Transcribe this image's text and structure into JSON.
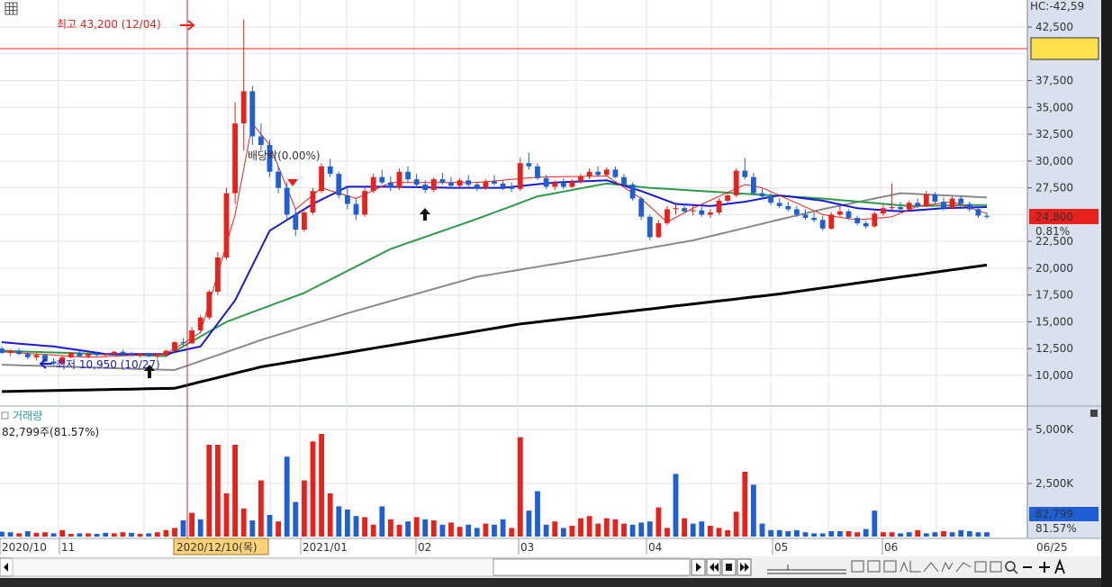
{
  "chart_data": {
    "type": "candlestick",
    "price_axis": {
      "ticks": [
        "42,500",
        "37,500",
        "35,000",
        "32,500",
        "30,000",
        "27,500",
        "22,500",
        "20,000",
        "17,500",
        "15,000",
        "12,500",
        "10,000"
      ],
      "top_label": "HC:-42,59",
      "current_price": "24,800",
      "current_change": "0.81%"
    },
    "volume_axis": {
      "ticks": [
        "5,000K",
        "2,500K"
      ],
      "current_volume": "82,799",
      "current_ratio": "81.57%"
    },
    "volume_legend": {
      "title": "거래량",
      "value": "82,799주(81.57%)"
    },
    "annotations": {
      "high": "최고 43,200 (12/04)",
      "low": "최저 10,950 (10/27)",
      "dividend": "배당락(0.00%)"
    },
    "x_labels": [
      "2020/10",
      "11",
      "2021/01",
      "02",
      "03",
      "04",
      "05",
      "06"
    ],
    "cursor_label": "2020/12/10(목)",
    "right_date": "06/25",
    "colors": {
      "up": "#e8211b",
      "down": "#1f5fd6",
      "ma5": "#e8211b",
      "ma20": "#1a1ad6",
      "ma60": "#2e9a4d",
      "ma120": "#8a8a8a",
      "ma240": "#000000"
    },
    "candles": [
      [
        12500,
        12700,
        12000,
        12100
      ],
      [
        12100,
        12400,
        11800,
        12300
      ],
      [
        12300,
        12500,
        11900,
        12000
      ],
      [
        12000,
        12200,
        11500,
        11700
      ],
      [
        11700,
        12100,
        11400,
        11900
      ],
      [
        11900,
        12000,
        11200,
        11300
      ],
      [
        11300,
        11600,
        10950,
        11100
      ],
      [
        11100,
        11800,
        11000,
        11700
      ],
      [
        11700,
        12200,
        11600,
        12100
      ],
      [
        12100,
        12300,
        11700,
        11800
      ],
      [
        11800,
        12100,
        11600,
        12000
      ],
      [
        12000,
        12200,
        11800,
        11900
      ],
      [
        11900,
        12100,
        11700,
        12000
      ],
      [
        12000,
        12300,
        11900,
        12200
      ],
      [
        12200,
        12400,
        11900,
        12000
      ],
      [
        12000,
        12200,
        11800,
        11900
      ],
      [
        11900,
        12100,
        11700,
        12000
      ],
      [
        12000,
        12100,
        11700,
        11800
      ],
      [
        11800,
        12000,
        11600,
        11900
      ],
      [
        11900,
        12400,
        11800,
        12300
      ],
      [
        12300,
        13200,
        12200,
        13100
      ],
      [
        13100,
        13500,
        12800,
        13000
      ],
      [
        13000,
        14500,
        12900,
        14200
      ],
      [
        14200,
        15600,
        14000,
        15400
      ],
      [
        15400,
        18000,
        15200,
        17800
      ],
      [
        17800,
        21500,
        17500,
        21000
      ],
      [
        21000,
        27500,
        20800,
        27000
      ],
      [
        27000,
        35500,
        26000,
        33500
      ],
      [
        33500,
        43200,
        31000,
        36500
      ],
      [
        36500,
        37000,
        31500,
        32300
      ],
      [
        32300,
        33500,
        31000,
        31500
      ],
      [
        31500,
        32000,
        28500,
        29000
      ],
      [
        29000,
        29500,
        27000,
        27500
      ],
      [
        27500,
        28000,
        24500,
        25000
      ],
      [
        25000,
        25500,
        23000,
        23600
      ],
      [
        23600,
        25500,
        23400,
        25200
      ],
      [
        25200,
        27500,
        25000,
        27200
      ],
      [
        27200,
        29800,
        27000,
        29500
      ],
      [
        29500,
        30200,
        28500,
        28800
      ],
      [
        28800,
        29000,
        26500,
        26800
      ],
      [
        26800,
        27500,
        25500,
        26000
      ],
      [
        26000,
        26500,
        24500,
        25000
      ],
      [
        25000,
        27500,
        24800,
        27200
      ],
      [
        27200,
        28800,
        27000,
        28500
      ],
      [
        28500,
        29200,
        27800,
        28000
      ],
      [
        28000,
        28600,
        27200,
        27500
      ],
      [
        27500,
        29300,
        27300,
        29000
      ],
      [
        29000,
        29500,
        28000,
        28300
      ],
      [
        28300,
        28800,
        27500,
        27800
      ],
      [
        27800,
        28200,
        27000,
        27300
      ],
      [
        27300,
        28500,
        27100,
        28300
      ],
      [
        28300,
        28900,
        27800,
        28000
      ],
      [
        28000,
        28500,
        27400,
        27700
      ],
      [
        27700,
        28400,
        27500,
        28200
      ],
      [
        28200,
        28700,
        27600,
        27800
      ],
      [
        27800,
        28100,
        27200,
        27500
      ],
      [
        27500,
        28300,
        27300,
        28100
      ],
      [
        28100,
        28700,
        27700,
        27900
      ],
      [
        27900,
        28200,
        27300,
        27600
      ],
      [
        27600,
        28000,
        27100,
        27400
      ],
      [
        27400,
        30300,
        27200,
        29800
      ],
      [
        29800,
        30800,
        29200,
        29500
      ],
      [
        29500,
        29800,
        28200,
        28400
      ],
      [
        28400,
        28700,
        27400,
        27600
      ],
      [
        27600,
        28200,
        27300,
        28000
      ],
      [
        28000,
        28400,
        27400,
        27600
      ],
      [
        27600,
        28300,
        27500,
        28100
      ],
      [
        28100,
        28800,
        27900,
        28600
      ],
      [
        28600,
        29300,
        28300,
        29000
      ],
      [
        29000,
        29500,
        28500,
        28700
      ],
      [
        28700,
        29400,
        28600,
        29200
      ],
      [
        29200,
        29500,
        28400,
        28500
      ],
      [
        28500,
        28800,
        27600,
        27800
      ],
      [
        27800,
        28000,
        26300,
        26500
      ],
      [
        26500,
        26700,
        24500,
        24800
      ],
      [
        24800,
        25000,
        22600,
        22900
      ],
      [
        22900,
        24500,
        22800,
        24200
      ],
      [
        24200,
        25800,
        24000,
        25500
      ],
      [
        25500,
        26000,
        25000,
        25600
      ],
      [
        25600,
        26000,
        25100,
        25300
      ],
      [
        25300,
        25800,
        24900,
        25400
      ],
      [
        25400,
        25700,
        24800,
        25000
      ],
      [
        25000,
        25500,
        24700,
        25200
      ],
      [
        25200,
        26500,
        25000,
        26300
      ],
      [
        26300,
        27000,
        26000,
        26800
      ],
      [
        26800,
        29300,
        26600,
        29100
      ],
      [
        29100,
        30300,
        28300,
        28500
      ],
      [
        28500,
        28900,
        26800,
        27000
      ],
      [
        27000,
        27400,
        26400,
        26700
      ],
      [
        26700,
        27000,
        25900,
        26100
      ],
      [
        26100,
        26500,
        25600,
        25800
      ],
      [
        25800,
        26200,
        25300,
        25500
      ],
      [
        25500,
        25800,
        24800,
        25000
      ],
      [
        25000,
        25500,
        24500,
        24700
      ],
      [
        24700,
        25200,
        24300,
        24500
      ],
      [
        24500,
        24900,
        23500,
        23700
      ],
      [
        23700,
        25200,
        23600,
        25000
      ],
      [
        25000,
        25800,
        24800,
        25300
      ],
      [
        25300,
        25500,
        24500,
        24700
      ],
      [
        24700,
        24900,
        24000,
        24200
      ],
      [
        24200,
        24400,
        23700,
        23900
      ],
      [
        23900,
        25300,
        23800,
        25100
      ],
      [
        25100,
        25900,
        24900,
        25600
      ],
      [
        25600,
        27900,
        25400,
        25700
      ],
      [
        25700,
        26200,
        25300,
        25500
      ],
      [
        25500,
        26300,
        25400,
        26100
      ],
      [
        26100,
        26500,
        25600,
        25800
      ],
      [
        25800,
        27200,
        25700,
        26900
      ],
      [
        26900,
        27100,
        26000,
        26200
      ],
      [
        26200,
        26600,
        25400,
        25600
      ],
      [
        25600,
        26700,
        25500,
        26500
      ],
      [
        26500,
        26800,
        25800,
        26000
      ],
      [
        26000,
        26200,
        25300,
        25500
      ],
      [
        25500,
        25700,
        24700,
        24900
      ],
      [
        24900,
        25200,
        24600,
        24800
      ]
    ],
    "ma5_knots": [
      [
        0,
        12200
      ],
      [
        10,
        11700
      ],
      [
        19,
        12000
      ],
      [
        23,
        14000
      ],
      [
        27,
        25000
      ],
      [
        29,
        33500
      ],
      [
        31,
        31500
      ],
      [
        34,
        25500
      ],
      [
        37,
        27500
      ],
      [
        41,
        26500
      ],
      [
        45,
        28000
      ],
      [
        55,
        28000
      ],
      [
        62,
        28500
      ],
      [
        70,
        28600
      ],
      [
        74,
        26500
      ],
      [
        77,
        24300
      ],
      [
        80,
        25600
      ],
      [
        86,
        27800
      ],
      [
        88,
        27500
      ],
      [
        95,
        25000
      ],
      [
        99,
        24500
      ],
      [
        103,
        24800
      ],
      [
        106,
        25800
      ],
      [
        110,
        26200
      ],
      [
        114,
        25100
      ]
    ],
    "ma20_knots": [
      [
        0,
        13100
      ],
      [
        6,
        12700
      ],
      [
        12,
        12000
      ],
      [
        19,
        12000
      ],
      [
        23,
        12700
      ],
      [
        27,
        17000
      ],
      [
        31,
        23500
      ],
      [
        36,
        26000
      ],
      [
        40,
        27600
      ],
      [
        45,
        27600
      ],
      [
        52,
        27500
      ],
      [
        58,
        27500
      ],
      [
        64,
        28000
      ],
      [
        70,
        28200
      ],
      [
        74,
        27200
      ],
      [
        78,
        26000
      ],
      [
        82,
        25800
      ],
      [
        86,
        26200
      ],
      [
        90,
        26800
      ],
      [
        95,
        26300
      ],
      [
        99,
        25600
      ],
      [
        104,
        25300
      ],
      [
        109,
        25600
      ],
      [
        114,
        25700
      ]
    ],
    "ma60_knots": [
      [
        0,
        12300
      ],
      [
        19,
        11800
      ],
      [
        26,
        15000
      ],
      [
        35,
        17700
      ],
      [
        45,
        21800
      ],
      [
        55,
        24600
      ],
      [
        62,
        26700
      ],
      [
        70,
        27900
      ],
      [
        75,
        27500
      ],
      [
        85,
        27000
      ],
      [
        95,
        26500
      ],
      [
        105,
        25800
      ],
      [
        114,
        25900
      ]
    ],
    "ma120_knots": [
      [
        0,
        11000
      ],
      [
        20,
        10500
      ],
      [
        30,
        13300
      ],
      [
        40,
        15800
      ],
      [
        55,
        19200
      ],
      [
        70,
        21200
      ],
      [
        80,
        22600
      ],
      [
        95,
        25500
      ],
      [
        104,
        27000
      ],
      [
        114,
        26600
      ]
    ],
    "ma240_knots": [
      [
        0,
        8500
      ],
      [
        20,
        8800
      ],
      [
        30,
        10800
      ],
      [
        60,
        14800
      ],
      [
        90,
        17600
      ],
      [
        114,
        20300
      ]
    ],
    "volume": [
      45,
      40,
      30,
      50,
      35,
      40,
      30,
      60,
      25,
      30,
      30,
      25,
      35,
      30,
      40,
      35,
      25,
      30,
      40,
      60,
      80,
      150,
      220,
      160,
      850,
      850,
      400,
      850,
      260,
      150,
      520,
      200,
      140,
      740,
      320,
      520,
      880,
      950,
      400,
      280,
      250,
      190,
      180,
      110,
      280,
      160,
      110,
      140,
      180,
      160,
      150,
      110,
      130,
      90,
      110,
      80,
      120,
      110,
      160,
      80,
      920,
      240,
      420,
      110,
      140,
      80,
      100,
      170,
      190,
      120,
      170,
      160,
      120,
      110,
      130,
      140,
      270,
      80,
      580,
      170,
      120,
      140,
      100,
      80,
      60,
      230,
      600,
      480,
      120,
      60,
      60,
      50,
      60,
      40,
      30,
      30,
      50,
      50,
      50,
      40,
      70,
      240,
      40,
      40,
      30,
      40,
      60,
      30,
      40,
      50,
      40,
      60,
      50,
      40,
      40
    ],
    "volume_down": [
      0,
      1,
      3,
      6,
      9,
      11,
      12,
      15,
      17,
      21,
      23,
      29,
      31,
      33,
      34,
      39,
      40,
      41,
      44,
      47,
      49,
      51,
      54,
      55,
      57,
      58,
      61,
      62,
      63,
      65,
      73,
      74,
      75,
      78,
      80,
      81,
      87,
      88,
      89,
      90,
      91,
      92,
      93,
      94,
      95,
      96,
      97,
      100,
      101,
      104,
      105,
      107,
      108,
      110,
      111,
      112,
      113,
      114
    ]
  }
}
